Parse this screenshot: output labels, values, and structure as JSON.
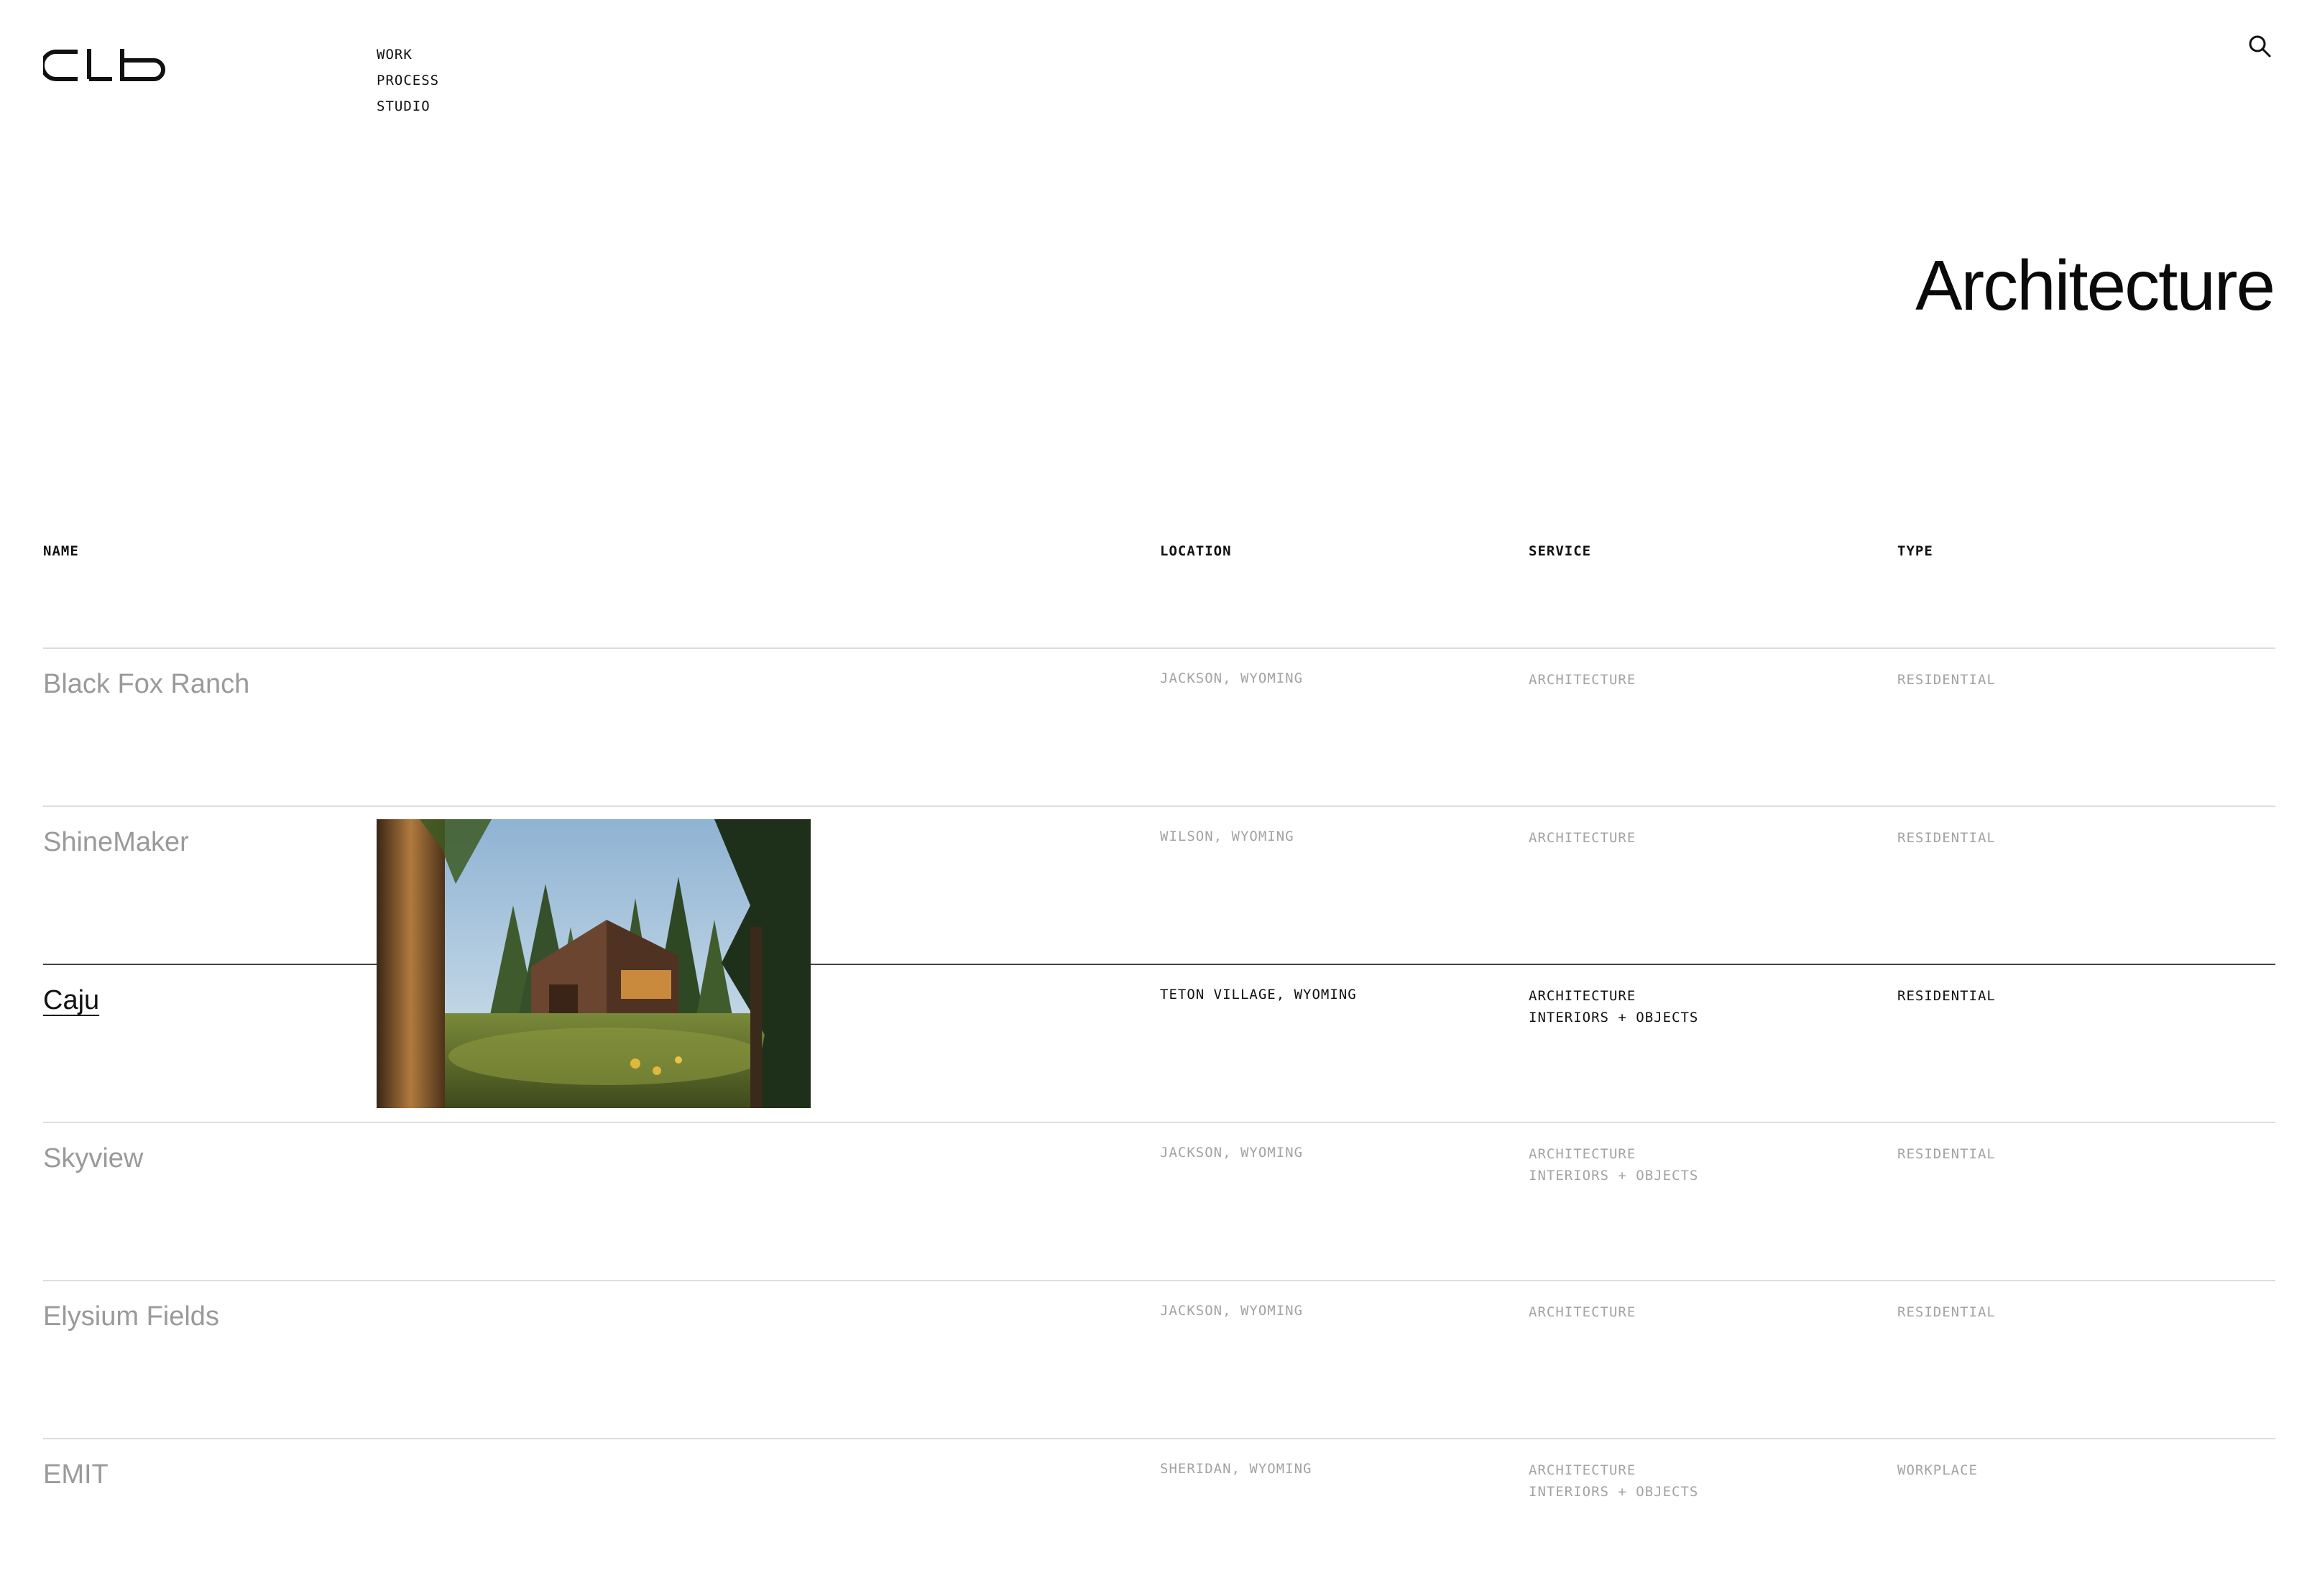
{
  "brand": {
    "logo_text": "clb"
  },
  "nav": {
    "items": [
      "WORK",
      "PROCESS",
      "STUDIO"
    ]
  },
  "page": {
    "title": "Architecture"
  },
  "table": {
    "headers": {
      "name": "NAME",
      "location": "LOCATION",
      "service": "SERVICE",
      "type": "TYPE"
    },
    "rows": [
      {
        "name": "Black Fox Ranch",
        "location": "JACKSON, WYOMING",
        "service": "ARCHITECTURE",
        "type": "RESIDENTIAL",
        "active": false
      },
      {
        "name": "ShineMaker",
        "location": "WILSON, WYOMING",
        "service": "ARCHITECTURE",
        "type": "RESIDENTIAL",
        "active": false
      },
      {
        "name": "Caju",
        "location": "TETON VILLAGE, WYOMING",
        "service": "ARCHITECTURE\nINTERIORS + OBJECTS",
        "type": "RESIDENTIAL",
        "active": true
      },
      {
        "name": "Skyview",
        "location": "JACKSON, WYOMING",
        "service": "ARCHITECTURE\nINTERIORS + OBJECTS",
        "type": "RESIDENTIAL",
        "active": false
      },
      {
        "name": "Elysium Fields",
        "location": "JACKSON, WYOMING",
        "service": "ARCHITECTURE",
        "type": "RESIDENTIAL",
        "active": false
      },
      {
        "name": "EMIT",
        "location": "SHERIDAN, WYOMING",
        "service": "ARCHITECTURE\nINTERIORS + OBJECTS",
        "type": "WORKPLACE",
        "active": false
      }
    ]
  },
  "icons": {
    "search": "search-icon"
  },
  "colors": {
    "text": "#111111",
    "muted": "#9a9a9a",
    "rule": "#dcdcdc",
    "active_rule": "#444444",
    "background": "#ffffff"
  }
}
